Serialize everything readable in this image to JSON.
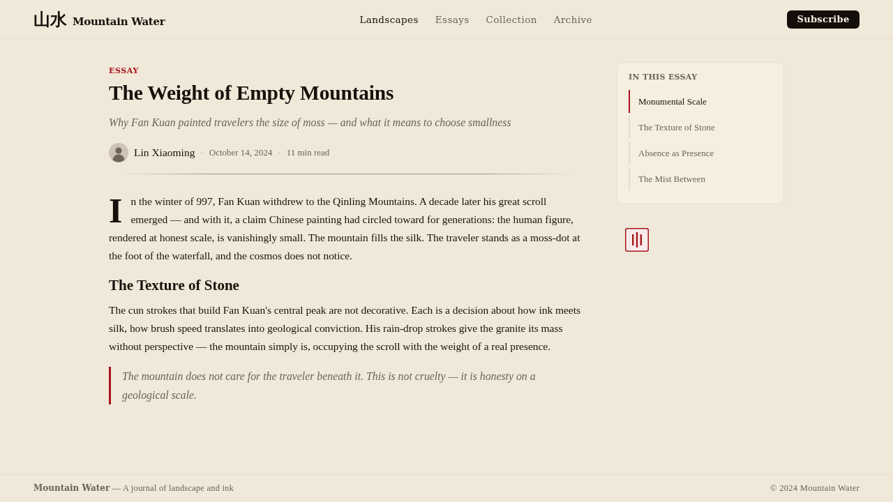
{
  "header": {
    "logo": {
      "mark": "山水",
      "name": "Mountain Water"
    },
    "nav": [
      {
        "label": "Landscapes",
        "selected": true
      },
      {
        "label": "Essays",
        "selected": false
      },
      {
        "label": "Collection",
        "selected": false
      },
      {
        "label": "Archive",
        "selected": false
      }
    ],
    "subscribe": "Subscribe"
  },
  "article": {
    "kicker": "ESSAY",
    "title": "The Weight of Empty Mountains",
    "subtitle": "Why Fan Kuan painted travelers the size of moss — and what it means to choose smallness",
    "meta": {
      "author": "Lin Xiaoming",
      "items": [
        {
          "separator": "·",
          "text": "October 14, 2024"
        },
        {
          "separator": "·",
          "text": "11 min read"
        }
      ]
    },
    "body": [
      {
        "kind": "paragraph",
        "drop_cap": true,
        "text": "In the winter of 997, Fan Kuan withdrew to the Qinling Mountains. A decade later his great scroll emerged — and with it, a claim Chinese painting had circled toward for generations: the human figure, rendered at honest scale, is vanishingly small. The mountain fills the silk. The traveler stands as a moss-dot at the foot of the waterfall, and the cosmos does not notice."
      },
      {
        "kind": "heading",
        "text": "The Texture of Stone"
      },
      {
        "kind": "paragraph",
        "drop_cap": false,
        "text": "The cun strokes that build Fan Kuan's central peak are not decorative. Each is a decision about how ink meets silk, how brush speed translates into geological conviction. His rain-drop strokes give the granite its mass without perspective — the mountain simply is, occupying the scroll with the weight of a real presence."
      },
      {
        "kind": "quote",
        "text": "The mountain does not care for the traveler beneath it. This is not cruelty — it is honesty on a geological scale."
      }
    ]
  },
  "sidebar": {
    "toc": {
      "title": "IN THIS ESSAY",
      "items": [
        {
          "label": "Monumental Scale",
          "selected": true
        },
        {
          "label": "The Texture of Stone",
          "selected": false
        },
        {
          "label": "Absence as Presence",
          "selected": false
        },
        {
          "label": "The Mist Between",
          "selected": false
        }
      ]
    }
  },
  "footer": {
    "tagline": "**Mountain Water** — A journal of landscape and ink",
    "copyright": "© 2024 Mountain Water"
  }
}
